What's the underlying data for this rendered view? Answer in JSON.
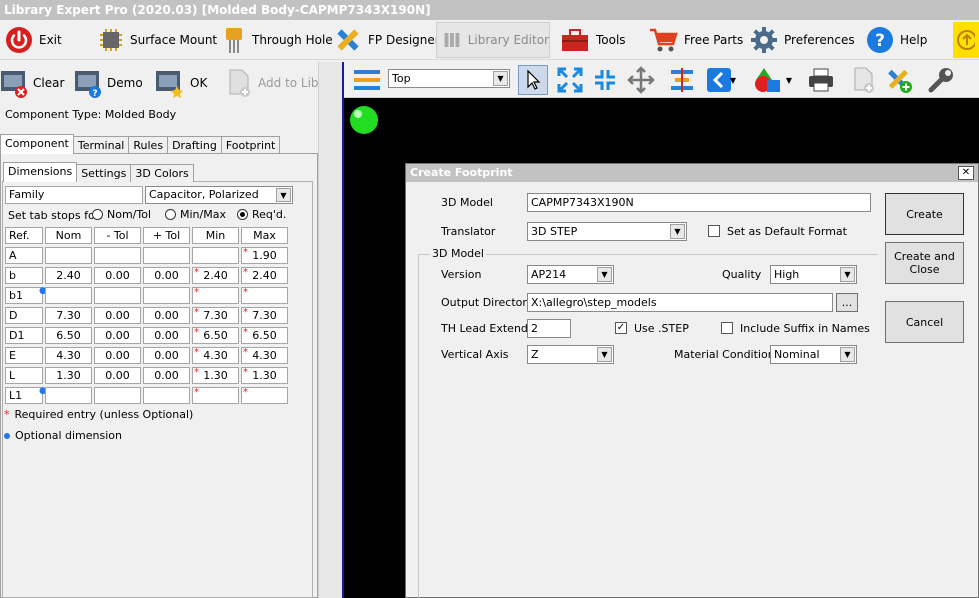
{
  "window_title": "Library Expert Pro (2020.03) [Molded Body-CAPMP7343X190N]",
  "main_toolbar": {
    "exit": "Exit",
    "surface_mount": "Surface Mount",
    "through_hole": "Through Hole",
    "fp_designer": "FP Designer",
    "library_editor": "Library Editor",
    "tools": "Tools",
    "free_parts": "Free Parts",
    "preferences": "Preferences",
    "help": "Help"
  },
  "left_toolbar": {
    "clear": "Clear",
    "demo": "Demo",
    "ok": "OK",
    "add_to_lib": "Add to Lib"
  },
  "component_type": "Component Type: Molded Body",
  "tabs": [
    "Component",
    "Terminal",
    "Rules",
    "Drafting",
    "Footprint"
  ],
  "subtabs": [
    "Dimensions",
    "Settings",
    "3D Colors"
  ],
  "family": {
    "label": "Family",
    "value": "Capacitor, Polarized"
  },
  "tabstops": {
    "label": "Set tab stops for:",
    "options": [
      "Nom/Tol",
      "Min/Max",
      "Req'd."
    ],
    "selected": "Req'd."
  },
  "dims_table": {
    "headers": [
      "Ref.",
      "Nom",
      "- Tol",
      "+ Tol",
      "Min",
      "Max"
    ],
    "rows": [
      {
        "ref": "A",
        "nom": "",
        "ntol": "",
        "ptol": "",
        "min": "",
        "max": "1.90",
        "req_min": false,
        "req_max": true,
        "optional": false
      },
      {
        "ref": "b",
        "nom": "2.40",
        "ntol": "0.00",
        "ptol": "0.00",
        "min": "2.40",
        "max": "2.40",
        "req_min": true,
        "req_max": true,
        "optional": false
      },
      {
        "ref": "b1",
        "nom": "",
        "ntol": "",
        "ptol": "",
        "min": "",
        "max": "",
        "req_min": true,
        "req_max": true,
        "optional": true
      },
      {
        "ref": "D",
        "nom": "7.30",
        "ntol": "0.00",
        "ptol": "0.00",
        "min": "7.30",
        "max": "7.30",
        "req_min": true,
        "req_max": true,
        "optional": false
      },
      {
        "ref": "D1",
        "nom": "6.50",
        "ntol": "0.00",
        "ptol": "0.00",
        "min": "6.50",
        "max": "6.50",
        "req_min": true,
        "req_max": true,
        "optional": false
      },
      {
        "ref": "E",
        "nom": "4.30",
        "ntol": "0.00",
        "ptol": "0.00",
        "min": "4.30",
        "max": "4.30",
        "req_min": true,
        "req_max": true,
        "optional": false
      },
      {
        "ref": "L",
        "nom": "1.30",
        "ntol": "0.00",
        "ptol": "0.00",
        "min": "1.30",
        "max": "1.30",
        "req_min": true,
        "req_max": true,
        "optional": false
      },
      {
        "ref": "L1",
        "nom": "",
        "ntol": "",
        "ptol": "",
        "min": "",
        "max": "",
        "req_min": true,
        "req_max": true,
        "optional": true
      }
    ]
  },
  "legend": {
    "required": "Required entry (unless Optional)",
    "optional": "Optional dimension"
  },
  "view_toolbar": {
    "layer": "Top"
  },
  "dialog": {
    "title": "Create Footprint",
    "model_label": "3D Model",
    "model_value": "CAPMP7343X190N",
    "translator_label": "Translator",
    "translator_value": "3D STEP",
    "default_format_label": "Set as Default Format",
    "default_format_checked": false,
    "group_label": "3D Model",
    "version_label": "Version",
    "version_value": "AP214",
    "quality_label": "Quality",
    "quality_value": "High",
    "output_dir_label": "Output Directory",
    "output_dir_value": "X:\\allegro\\step_models",
    "browse_label": "...",
    "th_lead_label": "TH Lead Extend",
    "th_lead_value": "2",
    "use_step_label": "Use .STEP",
    "use_step_checked": true,
    "include_suffix_label": "Include Suffix in Names",
    "include_suffix_checked": false,
    "vertical_axis_label": "Vertical Axis",
    "vertical_axis_value": "Z",
    "material_label": "Material Condition",
    "material_value": "Nominal",
    "create_btn": "Create",
    "create_close_btn_1": "Create and",
    "create_close_btn_2": "Close",
    "cancel_btn": "Cancel",
    "close_glyph": "✕"
  },
  "colors": {
    "accent": "#1a1aa0",
    "required": "#d22222",
    "optional": "#2277ee"
  }
}
